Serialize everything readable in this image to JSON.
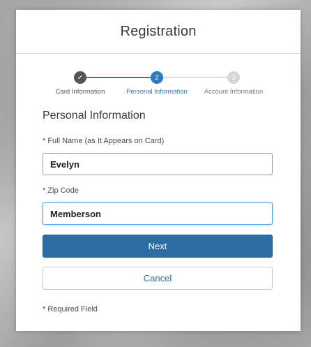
{
  "dialog": {
    "title": "Registration"
  },
  "stepper": {
    "steps": [
      {
        "label": "Card Information",
        "state": "completed",
        "marker": "✓"
      },
      {
        "label": "Personal Information",
        "state": "active",
        "marker": "2"
      },
      {
        "label": "Account Information",
        "state": "pending",
        "marker": "3"
      }
    ],
    "colors": {
      "completed": "#555555",
      "active": "#2a7bc0",
      "pending": "#d6d6d6"
    }
  },
  "form": {
    "section_title": "Personal Information",
    "full_name": {
      "label": "* Full Name (as It Appears on Card)",
      "value": "Evelyn"
    },
    "zip_code": {
      "label": "* Zip Code",
      "value": "Memberson"
    },
    "next_label": "Next",
    "cancel_label": "Cancel",
    "required_note": "* Required Field"
  },
  "colors": {
    "primary": "#2a6ea4",
    "focus_border": "#5fa3d6"
  }
}
